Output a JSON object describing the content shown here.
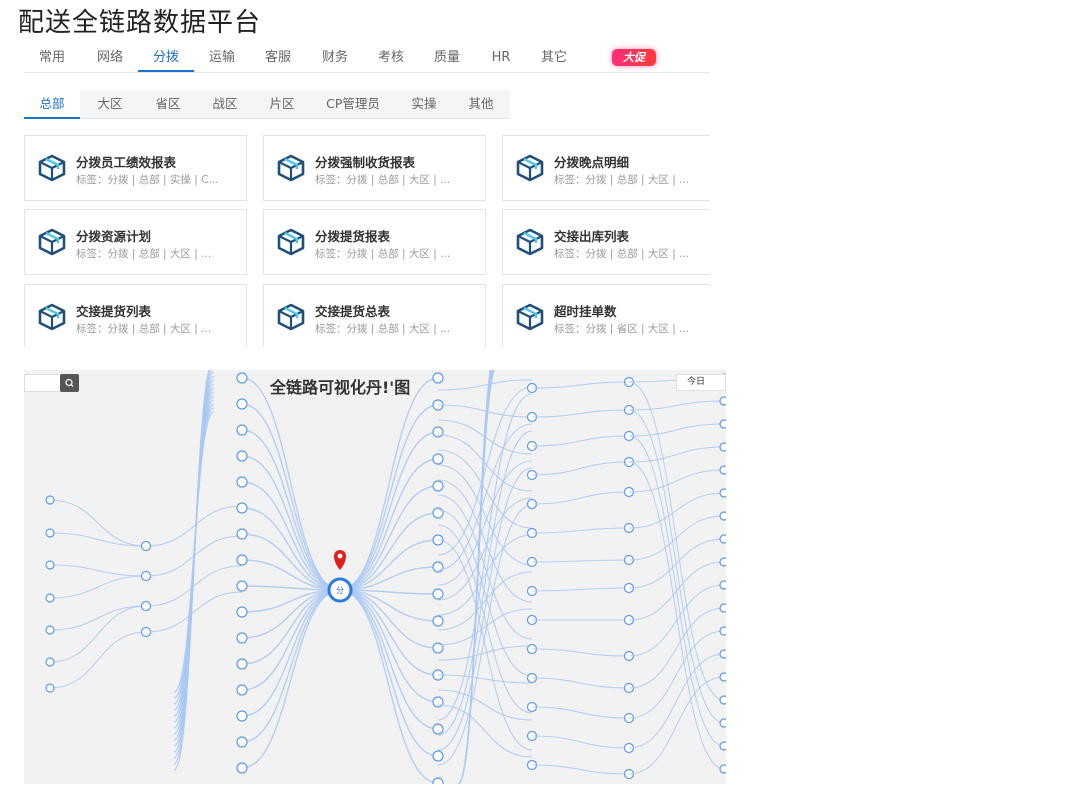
{
  "page": {
    "title": "配送全链路数据平台"
  },
  "main_tabs": [
    {
      "label": "常用"
    },
    {
      "label": "网络"
    },
    {
      "label": "分拨"
    },
    {
      "label": "运输"
    },
    {
      "label": "客服"
    },
    {
      "label": "财务"
    },
    {
      "label": "考核"
    },
    {
      "label": "质量"
    },
    {
      "label": "HR"
    },
    {
      "label": "其它"
    }
  ],
  "active_main_tab": "分拨",
  "promo": {
    "label": "大促"
  },
  "sub_tabs": [
    {
      "label": "总部"
    },
    {
      "label": "大区"
    },
    {
      "label": "省区"
    },
    {
      "label": "战区"
    },
    {
      "label": "片区"
    },
    {
      "label": "CP管理员"
    },
    {
      "label": "实操"
    },
    {
      "label": "其他"
    }
  ],
  "active_sub_tab": "总部",
  "cards": [
    {
      "title": "分拨员工绩效报表",
      "tags": "标签：分拨 | 总部 | 实操 | C..."
    },
    {
      "title": "分拨强制收货报表",
      "tags": "标签：分拨 | 总部 | 大区 | ..."
    },
    {
      "title": "分拨晚点明细",
      "tags": "标签：分拨 | 总部 | 大区 | ..."
    },
    {
      "title": "分拨资源计划",
      "tags": "标签：分拨 | 总部 | 大区 | ..."
    },
    {
      "title": "分拨提货报表",
      "tags": "标签：分拨 | 总部 | 大区 | ..."
    },
    {
      "title": "交接出库列表",
      "tags": "标签：分拨 | 总部 | 大区 | ..."
    },
    {
      "title": "交接提货列表",
      "tags": "标签：分拨 | 总部 | 大区 | ..."
    },
    {
      "title": "交接提货总表",
      "tags": "标签：分拨 | 总部 | 大区 | ..."
    },
    {
      "title": "超时挂单数",
      "tags": "标签：分拨 | 省区 | 大区 | ..."
    }
  ],
  "visualization": {
    "title": "全链路可视化丹!'图",
    "date_selector": "今日",
    "search_icon": "search-icon",
    "center_icon": "location-pin-icon",
    "center_label": "分",
    "colors": {
      "link": "#a9c8f3",
      "node": "#5b9bea",
      "center": "#2d7be0",
      "pin": "#e02020"
    }
  },
  "colors": {
    "accent": "#1a73c9",
    "icon_dark": "#1f4f7a",
    "icon_light": "#4cc9e8"
  }
}
